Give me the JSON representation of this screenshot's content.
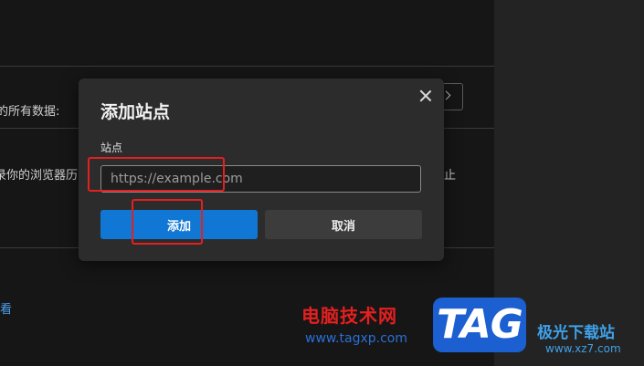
{
  "background": {
    "text_all_data": "的所有数据:",
    "text_history": "录你的浏览器历",
    "text_stop": "止",
    "link_view": "看"
  },
  "dialog": {
    "title": "添加站点",
    "field_label": "站点",
    "input_value": "",
    "input_placeholder": "https://example.com",
    "add_label": "添加",
    "cancel_label": "取消",
    "close_icon": "close-icon"
  },
  "watermark": {
    "site_name": "电脑技术网",
    "site_url": "www.tagxp.com",
    "logo_text": "TAG",
    "site_name_2": "极光下载站",
    "site_url_2": "www.xz7.com"
  },
  "colors": {
    "accent": "#1177d4",
    "annotation": "#e3201f",
    "dialog_bg": "#2c2c2c"
  }
}
